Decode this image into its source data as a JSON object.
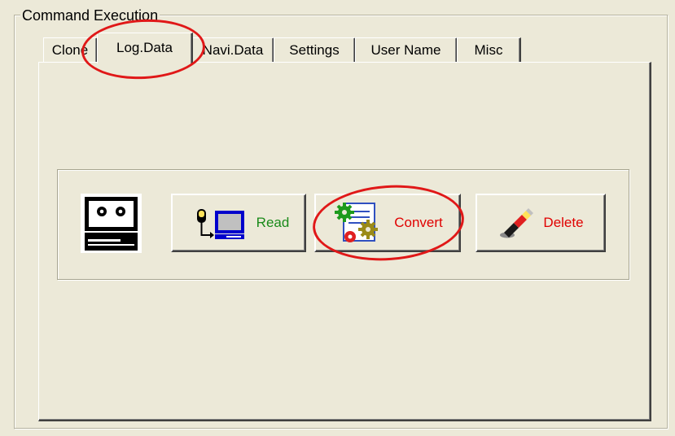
{
  "group": {
    "title": "Command Execution"
  },
  "tabs": [
    {
      "label": "Clone"
    },
    {
      "label": "Log.Data"
    },
    {
      "label": "Navi.Data"
    },
    {
      "label": "Settings"
    },
    {
      "label": "User Name"
    },
    {
      "label": "Misc"
    }
  ],
  "active_tab": "Log.Data",
  "buttons": {
    "read": {
      "label": "Read",
      "color": "#1a8a1a",
      "icon": "download-to-pc-icon"
    },
    "convert": {
      "label": "Convert",
      "color": "#e00000",
      "icon": "gears-document-icon"
    },
    "delete": {
      "label": "Delete",
      "color": "#e00000",
      "icon": "eraser-icon"
    }
  },
  "status_icon": "computer-face-icon",
  "highlight_color": "#e01818"
}
